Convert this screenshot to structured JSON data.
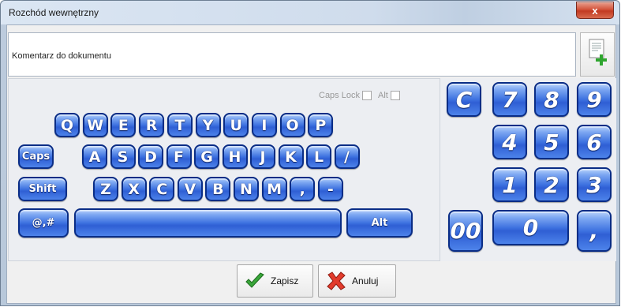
{
  "window": {
    "title": "Rozchód wewnętrzny",
    "close_label": "x"
  },
  "comment": {
    "placeholder": "Komentarz  do dokumentu"
  },
  "indicators": {
    "caps_lock": "Caps Lock",
    "alt": "Alt"
  },
  "keyboard": {
    "row1": [
      "Q",
      "W",
      "E",
      "R",
      "T",
      "Y",
      "U",
      "I",
      "O",
      "P"
    ],
    "row2": [
      "Caps",
      "A",
      "S",
      "D",
      "F",
      "G",
      "H",
      "J",
      "K",
      "L",
      "/"
    ],
    "row3": [
      "Shift",
      "Z",
      "X",
      "C",
      "V",
      "B",
      "N",
      "M",
      ",",
      "-"
    ],
    "row4": {
      "special": "@,#",
      "space": "",
      "alt": "Alt"
    }
  },
  "numpad": {
    "keys": [
      "C",
      "7",
      "8",
      "9",
      "4",
      "5",
      "6",
      "1",
      "2",
      "3",
      "00",
      "0",
      ","
    ]
  },
  "actions": {
    "save": "Zapisz",
    "cancel": "Anuluj"
  },
  "colors": {
    "key_blue": "#3e72e0",
    "key_border": "#0a2d86",
    "close_red": "#c23a22"
  },
  "icons": {
    "document_add": "document-add-icon",
    "save": "checkmark-icon",
    "cancel": "x-mark-icon"
  }
}
